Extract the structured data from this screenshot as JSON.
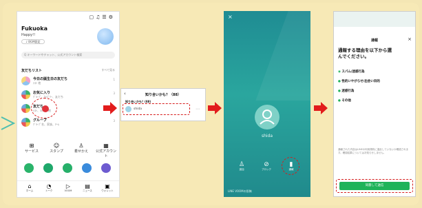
{
  "phone1": {
    "profile_name": "Fukuoka",
    "status_msg": "Happy!!",
    "bgm_pill": "♪ BGM設定",
    "search_placeholder": "Q  キーワードやチャット、公式アカウント検索",
    "list_heading": "友だちリスト",
    "list_more": "すべて見る",
    "rows": [
      {
        "title": "今日の誕生日の友だち",
        "sub": "ﾃｽﾄ 他",
        "count": "1"
      },
      {
        "title": "お気に入り",
        "sub": "ｸﾞﾙｰﾌﾟ、ｶﾃｺﾞﾘｰ、友だち",
        "count": "3"
      },
      {
        "title": "友だち",
        "sub": "ﾃｽﾄ、ﾖｼﾀﾞ、他",
        "count": "5"
      },
      {
        "title": "グループ",
        "sub": "ｸﾞﾙｰﾌﾟ名、家族、ﾁｰﾑ",
        "count": "3"
      }
    ],
    "services": [
      "サービス",
      "スタンプ",
      "着せかえ",
      "公式アカウント"
    ],
    "tabs": [
      "ホーム",
      "トーク",
      "VOOM",
      "ニュース",
      "ウォレット"
    ],
    "highlight_color": "#d61c1c"
  },
  "phone2": {
    "title": "知り合いかも？（88）",
    "section": "知り合いかも？(88)",
    "user_name": "shida"
  },
  "phone3": {
    "user_name": "shida",
    "actions": [
      "追加",
      "ブロック",
      "通報"
    ],
    "footer": "LINE VOOMの投稿"
  },
  "phone4": {
    "header_title": "通報",
    "prompt": "通報する理由を以下から選んでください。",
    "reasons": [
      "スパム/迷惑行為",
      "性的いやがらせ/出会い目的",
      "迷惑行為",
      "その他"
    ],
    "notice": "通報された内容はLINEの利用規約に違反していないか確認されます。確認結果についてはお知らせしません。",
    "submit_label": "同意して送信",
    "accent": "#1fb35a"
  },
  "colors": {
    "background": "#f4e6b4",
    "arrow": "#e21c1c",
    "connector": "#4fbfb0"
  }
}
